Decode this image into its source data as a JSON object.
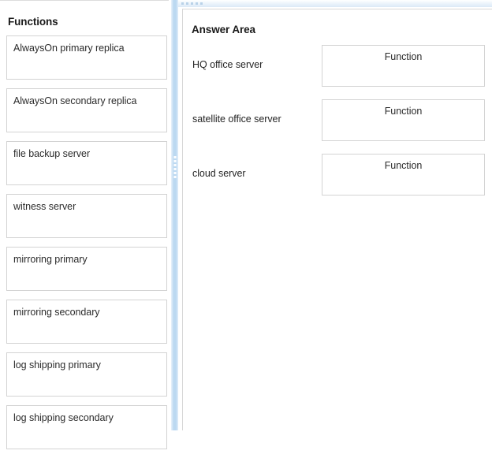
{
  "left_panel": {
    "title": "Functions",
    "items": [
      {
        "label": "AlwaysOn primary replica"
      },
      {
        "label": "AlwaysOn secondary replica"
      },
      {
        "label": "file backup server"
      },
      {
        "label": "witness server"
      },
      {
        "label": "mirroring primary"
      },
      {
        "label": "mirroring secondary"
      },
      {
        "label": "log shipping primary"
      },
      {
        "label": "log shipping secondary"
      }
    ]
  },
  "splitter": {
    "icon": "vertical-grip-dots",
    "color": "#bcd9f1",
    "dot_count": 6
  },
  "top_grip": {
    "icon": "horizontal-grip-dots",
    "color": "#b9d2e8",
    "dot_count": 5
  },
  "right_panel": {
    "title": "Answer Area",
    "rows": [
      {
        "label": "HQ office server",
        "drop_placeholder": "Function"
      },
      {
        "label": "satellite office server",
        "drop_placeholder": "Function"
      },
      {
        "label": "cloud server",
        "drop_placeholder": "Function"
      }
    ]
  },
  "colors": {
    "splitter": "#bcd9f1",
    "box_border": "#d3d3d3",
    "text": "#2b2b2b",
    "heading": "#1a1a1a",
    "background": "#ffffff"
  }
}
